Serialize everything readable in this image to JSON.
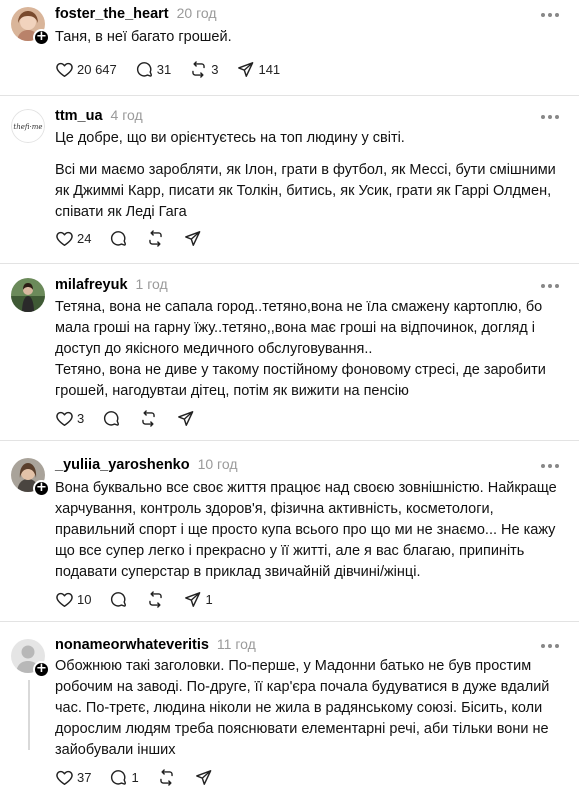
{
  "posts": [
    {
      "username": "foster_the_heart",
      "time": "20 год",
      "paragraphs": [
        "Таня, в неї багато грошей."
      ],
      "likes": "20 647",
      "replies": "31",
      "reposts": "3",
      "shares": "141"
    },
    {
      "username": "ttm_ua",
      "time": "4 год",
      "paragraphs": [
        "Це добре, що ви орієнтуєтесь на топ людину у світі.",
        "Всі ми маємо заробляти, як Ілон, грати в футбол, як Мессі, бути смішними як Джиммі Карр, писати як Толкін, битись, як Усик, грати як Гаррі Олдмен, співати як Леді Гага"
      ],
      "likes": "24",
      "replies": "",
      "reposts": "",
      "shares": ""
    },
    {
      "username": "milafreyuk",
      "time": "1 год",
      "paragraphs": [
        "Тетяна, вона не сапала город..тетяно,вона не їла смажену картоплю, бо мала гроші на гарну їжу..тетяно,,вона має гроші на відпочинок, догляд і доступ до якісного медичного обслуговування..",
        "Тетяно, вона не диве у такому постійному фоновому стресі, де заробити грошей, нагодувтаи дітец, потім як вижити на пенсію"
      ],
      "likes": "3",
      "replies": "",
      "reposts": "",
      "shares": ""
    },
    {
      "username": "_yuliia_yaroshenko",
      "time": "10 год",
      "paragraphs": [
        "Вона буквально все своє життя працює над своєю зовнішністю. Найкраще харчування, контроль здоров'я, фізична активність, косметологи, правильний спорт і ще просто купа всього про що ми не знаємо... Не кажу що все супер легко і прекрасно у її житті, але я вас благаю, припиніть подавати суперстар в приклад звичайній дівчині/жінці."
      ],
      "likes": "10",
      "replies": "",
      "reposts": "",
      "shares": "1"
    },
    {
      "username": "nonameorwhateveritis",
      "time": "11 год",
      "paragraphs": [
        "Обожнюю такі заголовки. По-перше, у Мадонни батько не був простим робочим на заводі. По-друге, її кар'єра почала будуватися в дуже вдалий час. По-третє, людина ніколи не жила в радянському союзі. Бісить, коли дорослим людям треба пояснювати елементарні речі, аби тільки вони не зайобували інших"
      ],
      "likes": "37",
      "replies": "1",
      "reposts": "",
      "shares": ""
    }
  ],
  "icons": {
    "like": "heart-icon",
    "reply": "comment-icon",
    "repost": "repost-icon",
    "share": "share-icon",
    "more": "more-icon",
    "follow": "plus-icon"
  }
}
